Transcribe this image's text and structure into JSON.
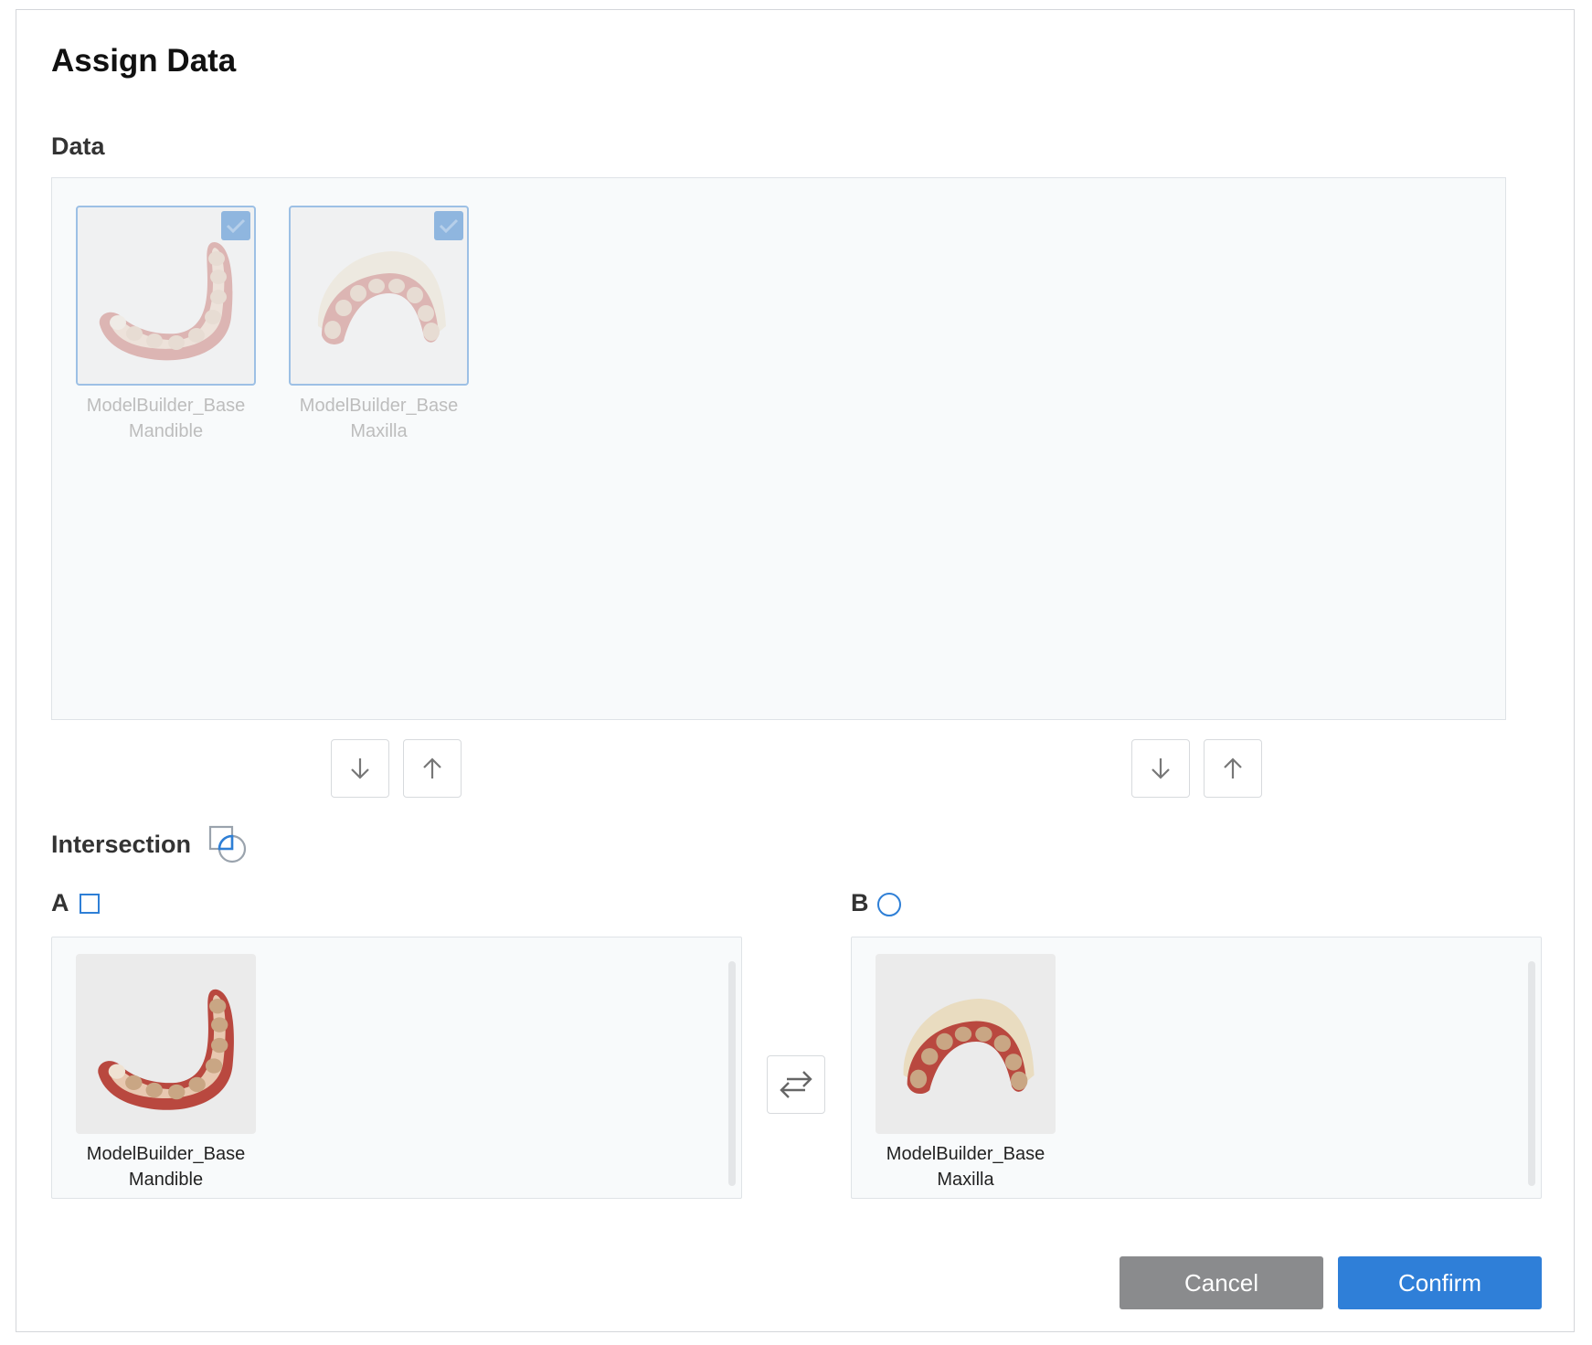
{
  "dialog": {
    "title": "Assign Data"
  },
  "data_section": {
    "label": "Data",
    "items": [
      {
        "name_line1": "ModelBuilder_Base",
        "name_line2": "Mandible",
        "checked": true,
        "model": "mandible"
      },
      {
        "name_line1": "ModelBuilder_Base",
        "name_line2": "Maxilla",
        "checked": true,
        "model": "maxilla"
      }
    ]
  },
  "move_buttons": {
    "a_down": "arrow-down-icon",
    "a_up": "arrow-up-icon",
    "b_down": "arrow-down-icon",
    "b_up": "arrow-up-icon"
  },
  "intersection": {
    "label": "Intersection"
  },
  "group_a": {
    "label": "A",
    "items": [
      {
        "name_line1": "ModelBuilder_Base",
        "name_line2": "Mandible",
        "model": "mandible"
      }
    ]
  },
  "group_b": {
    "label": "B",
    "items": [
      {
        "name_line1": "ModelBuilder_Base",
        "name_line2": "Maxilla",
        "model": "maxilla"
      }
    ]
  },
  "footer": {
    "cancel_label": "Cancel",
    "confirm_label": "Confirm"
  },
  "colors": {
    "accent": "#2f7fd8",
    "cancel": "#8a8b8d",
    "check": "#8fb6df"
  }
}
